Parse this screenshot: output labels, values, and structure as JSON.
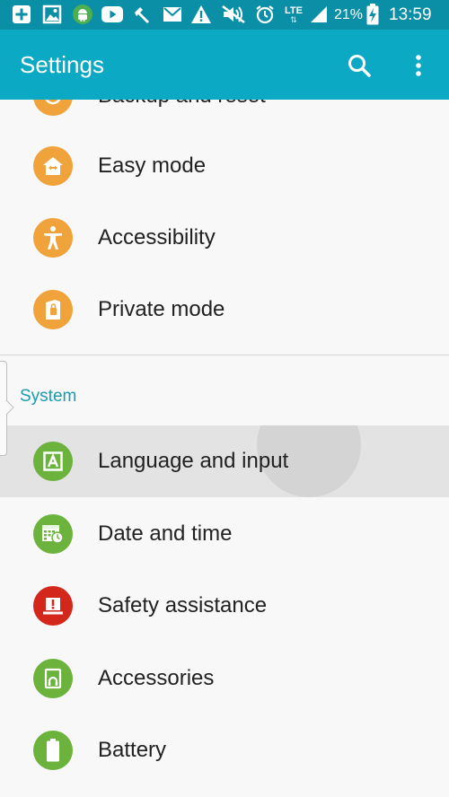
{
  "status_bar": {
    "icons": [
      "add-icon",
      "gallery-icon",
      "android-debug-icon",
      "youtube-icon",
      "tools-icon",
      "mail-icon",
      "warning-icon",
      "mute-icon",
      "alarm-icon",
      "lte-data-icon",
      "signal-icon",
      "battery-charging-icon"
    ],
    "network": "LTE",
    "battery": "21%",
    "time": "13:59"
  },
  "action_bar": {
    "title": "Settings",
    "search_icon": "search-icon",
    "menu_icon": "more-vertical-icon"
  },
  "items_top": [
    {
      "label": "Backup and reset",
      "icon": "backup-icon",
      "color": "#f0a33a"
    },
    {
      "label": "Easy mode",
      "icon": "easy-mode-icon",
      "color": "#f0a33a"
    },
    {
      "label": "Accessibility",
      "icon": "accessibility-icon",
      "color": "#f0a33a"
    },
    {
      "label": "Private mode",
      "icon": "private-mode-icon",
      "color": "#f0a33a"
    }
  ],
  "section": "System",
  "items_system": [
    {
      "label": "Language and input",
      "icon": "language-icon",
      "color": "#6cb33e",
      "pressed": true
    },
    {
      "label": "Date and time",
      "icon": "calendar-clock-icon",
      "color": "#6cb33e"
    },
    {
      "label": "Safety assistance",
      "icon": "safety-alert-icon",
      "color": "#d3271c"
    },
    {
      "label": "Accessories",
      "icon": "accessories-icon",
      "color": "#6cb33e"
    },
    {
      "label": "Battery",
      "icon": "battery-icon",
      "color": "#6cb33e"
    }
  ],
  "colors": {
    "status_bar": "#0a8fa6",
    "action_bar": "#0ca9c5",
    "section_text": "#1a9bb0",
    "orange": "#f0a33a",
    "green": "#6cb33e",
    "red": "#d3271c"
  }
}
